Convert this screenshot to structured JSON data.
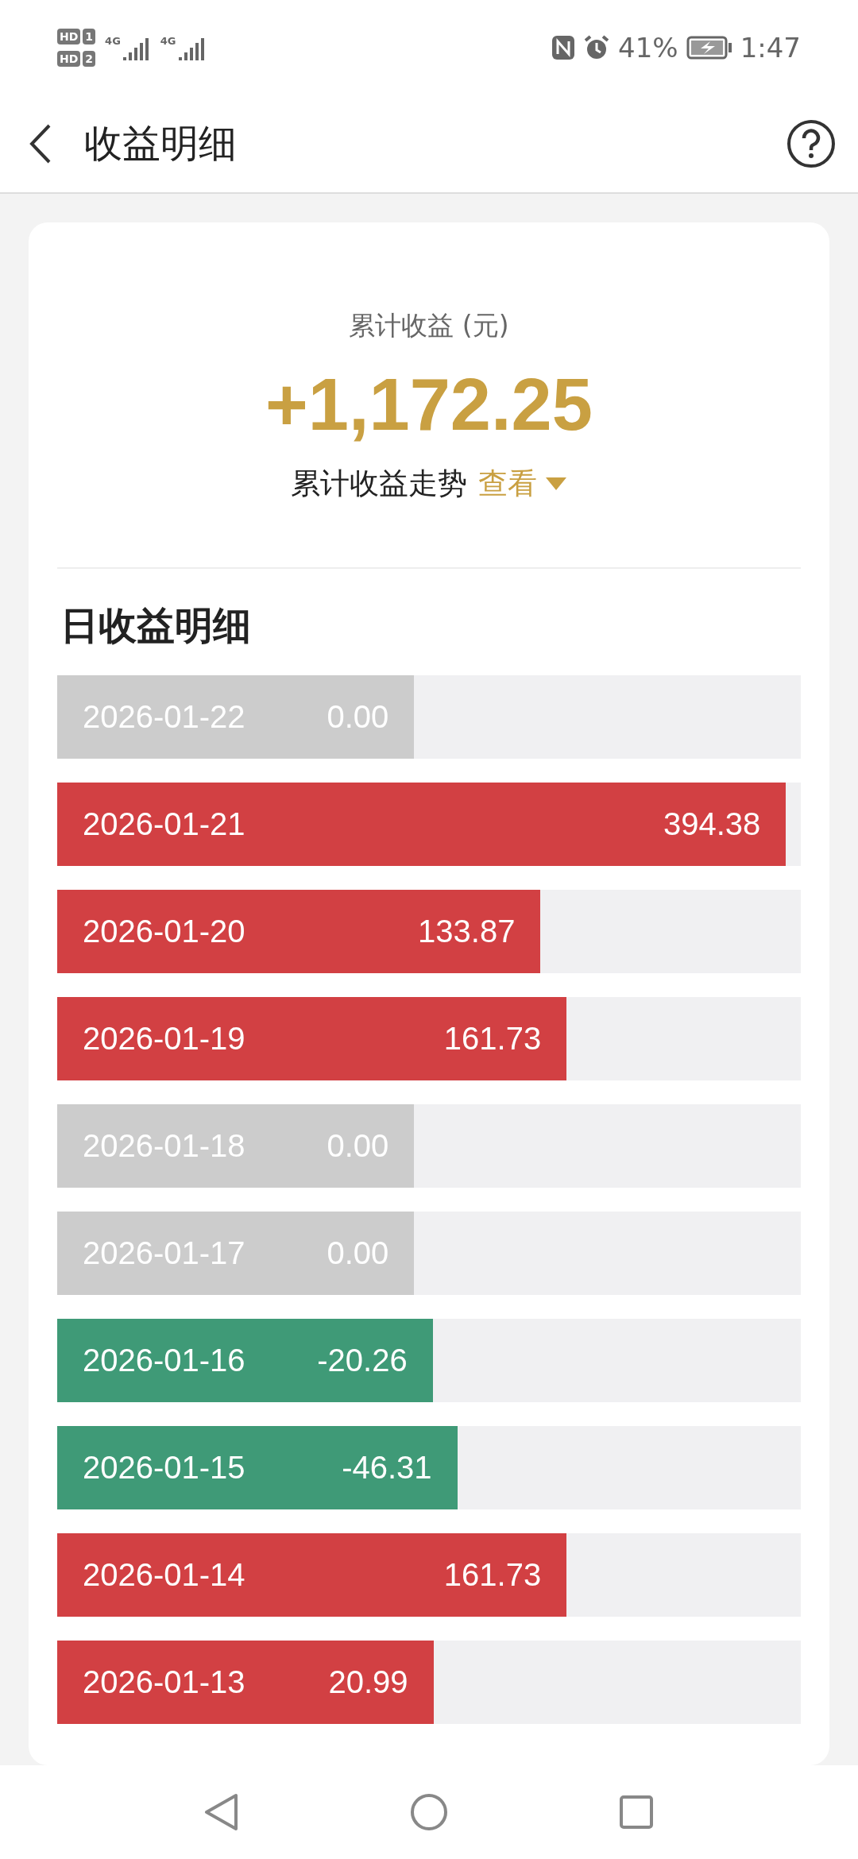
{
  "status_bar": {
    "sims": [
      {
        "badge": "HD",
        "slot": "1",
        "network": "4G"
      },
      {
        "badge": "HD",
        "slot": "2",
        "network": "4G"
      }
    ],
    "battery": "41%",
    "time": "1:47"
  },
  "header": {
    "title": "收益明细"
  },
  "summary": {
    "label": "累计收益 (元)",
    "amount": "+1,172.25",
    "trend_label": "累计收益走势",
    "trend_link": "查看"
  },
  "daily": {
    "title": "日收益明细",
    "rows": [
      {
        "date": "2026-01-22",
        "value": "0.00",
        "kind": "zero",
        "level": 0.48
      },
      {
        "date": "2026-01-21",
        "value": "394.38",
        "kind": "gain",
        "level": 0.98
      },
      {
        "date": "2026-01-20",
        "value": "133.87",
        "kind": "gain",
        "level": 0.65
      },
      {
        "date": "2026-01-19",
        "value": "161.73",
        "kind": "gain",
        "level": 0.685
      },
      {
        "date": "2026-01-18",
        "value": "0.00",
        "kind": "zero",
        "level": 0.48
      },
      {
        "date": "2026-01-17",
        "value": "0.00",
        "kind": "zero",
        "level": 0.48
      },
      {
        "date": "2026-01-16",
        "value": "-20.26",
        "kind": "loss",
        "level": 0.505
      },
      {
        "date": "2026-01-15",
        "value": "-46.31",
        "kind": "loss",
        "level": 0.538
      },
      {
        "date": "2026-01-14",
        "value": "161.73",
        "kind": "gain",
        "level": 0.685
      },
      {
        "date": "2026-01-13",
        "value": "20.99",
        "kind": "gain",
        "level": 0.506
      }
    ]
  }
}
